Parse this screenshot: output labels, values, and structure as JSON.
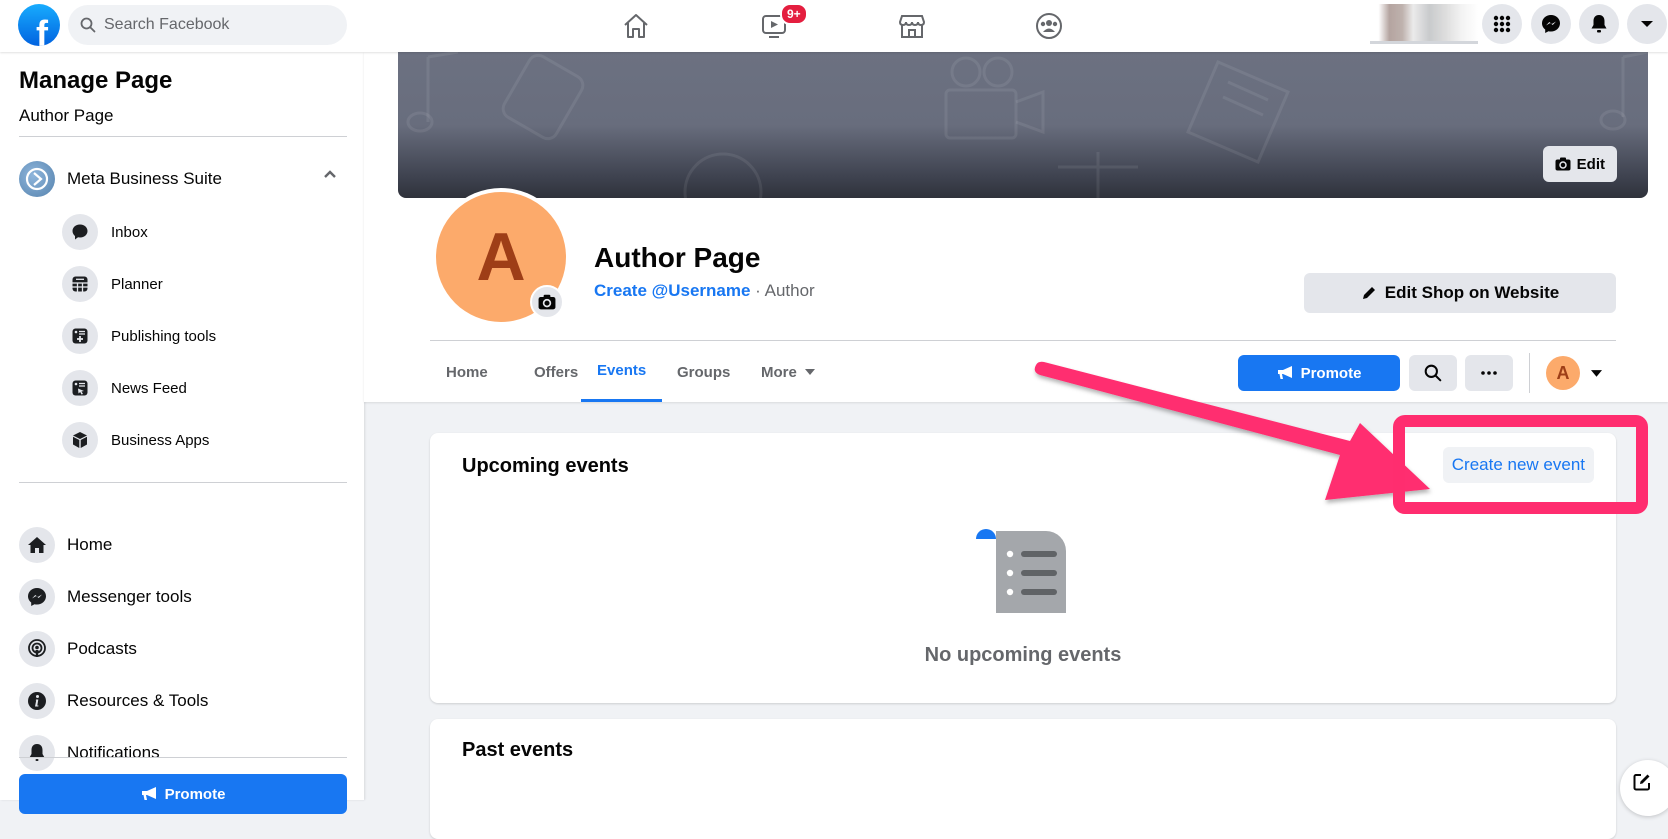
{
  "topbar": {
    "logo": "f",
    "search_placeholder": "Search Facebook",
    "nav": [
      {
        "name": "home",
        "icon": "home-icon"
      },
      {
        "name": "watch",
        "icon": "video-icon",
        "badge": "9+"
      },
      {
        "name": "marketplace",
        "icon": "store-icon"
      },
      {
        "name": "groups",
        "icon": "groups-icon"
      }
    ],
    "right_buttons": [
      "menu-grid-icon",
      "messenger-icon",
      "bell-icon",
      "caret-down-icon"
    ]
  },
  "sidebar": {
    "title": "Manage Page",
    "subtitle": "Author Page",
    "business_suite": {
      "label": "Meta Business Suite",
      "expanded": true
    },
    "sub_items": [
      {
        "label": "Inbox",
        "icon": "chat-bubble-icon"
      },
      {
        "label": "Planner",
        "icon": "calendar-grid-icon"
      },
      {
        "label": "Publishing tools",
        "icon": "publishing-icon"
      },
      {
        "label": "News Feed",
        "icon": "news-feed-icon"
      },
      {
        "label": "Business Apps",
        "icon": "cube-icon"
      }
    ],
    "items": [
      {
        "label": "Home",
        "icon": "home-icon"
      },
      {
        "label": "Messenger tools",
        "icon": "messenger-icon"
      },
      {
        "label": "Podcasts",
        "icon": "podcast-icon"
      },
      {
        "label": "Resources & Tools",
        "icon": "info-icon"
      },
      {
        "label": "Notifications",
        "icon": "bell-icon"
      }
    ],
    "promote_label": "Promote"
  },
  "profile": {
    "cover_edit_label": "Edit",
    "avatar_letter": "A",
    "page_name": "Author Page",
    "username_link": "Create @Username",
    "separator": " · ",
    "category": "Author",
    "edit_shop_label": "Edit Shop on Website",
    "tabs": [
      {
        "label": "Home",
        "active": false
      },
      {
        "label": "Offers",
        "active": false
      },
      {
        "label": "Events",
        "active": true
      },
      {
        "label": "Groups",
        "active": false
      },
      {
        "label": "More",
        "active": false,
        "dropdown": true
      }
    ],
    "promote_label": "Promote",
    "mini_avatar_letter": "A"
  },
  "events": {
    "upcoming_title": "Upcoming events",
    "create_label": "Create new event",
    "empty_label": "No upcoming events",
    "past_title": "Past events"
  },
  "colors": {
    "brand_blue": "#1877f2",
    "annotation_pink": "#ff2d6f",
    "avatar_orange": "#fcaa6b"
  }
}
